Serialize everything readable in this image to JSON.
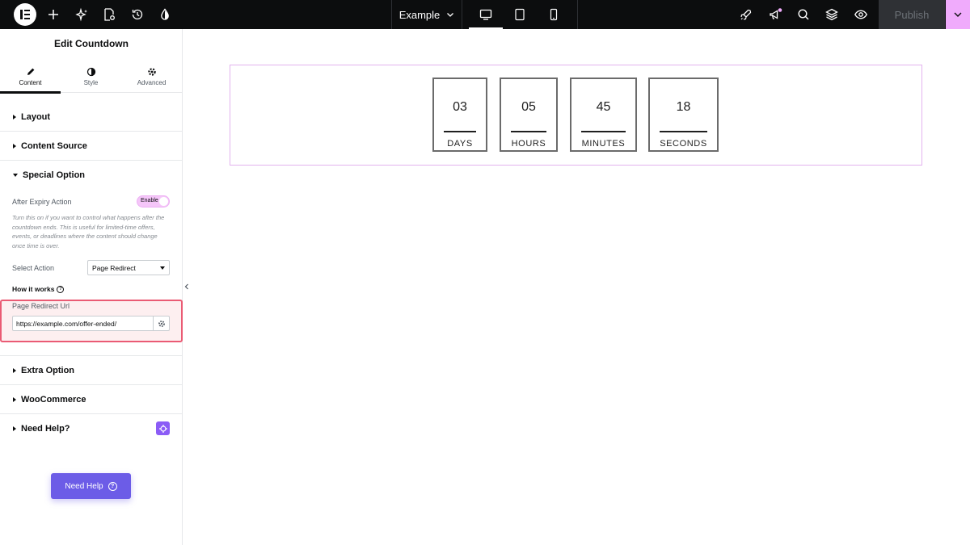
{
  "topbar": {
    "page_name": "Example",
    "publish_label": "Publish",
    "left_icons": [
      "elementor-logo-icon",
      "plus-icon",
      "ai-sparkle-icon",
      "page-settings-icon",
      "history-icon",
      "color-drop-icon"
    ],
    "right_icons": [
      "rocket-icon",
      "megaphone-icon",
      "search-icon",
      "layers-icon",
      "eye-icon"
    ],
    "devices": [
      "desktop-icon",
      "tablet-icon",
      "mobile-icon"
    ],
    "active_device": "desktop"
  },
  "panel": {
    "title": "Edit Countdown",
    "tabs": [
      {
        "label": "Content",
        "icon": "pencil-icon",
        "active": true
      },
      {
        "label": "Style",
        "icon": "contrast-icon",
        "active": false
      },
      {
        "label": "Advanced",
        "icon": "gear-icon",
        "active": false
      }
    ],
    "sections": {
      "layout": "Layout",
      "content_source": "Content Source",
      "special_option": "Special Option",
      "extra_option": "Extra Option",
      "woocommerce": "WooCommerce",
      "need_help": "Need Help?"
    },
    "special": {
      "after_expiry_label": "After Expiry Action",
      "toggle_label": "Enable",
      "description": "Turn this on if you want to control what happens after the countdown ends. This is useful for limited-time offers, events, or deadlines where the content should change once time is over.",
      "select_action_label": "Select Action",
      "select_action_value": "Page Redirect",
      "how_it_works": "How it works",
      "redirect_url_label": "Page Redirect Url",
      "redirect_url_value": "https://example.com/offer-ended/"
    },
    "need_help_button": "Need Help"
  },
  "countdown": {
    "items": [
      {
        "value": "03",
        "label": "DAYS"
      },
      {
        "value": "05",
        "label": "HOURS"
      },
      {
        "value": "45",
        "label": "MINUTES"
      },
      {
        "value": "18",
        "label": "SECONDS"
      }
    ]
  },
  "colors": {
    "topbar_bg": "#0c0d0e",
    "accent_pink": "#f0abfc",
    "highlight_border": "#ea5b74",
    "help_button": "#6c5ce7"
  }
}
